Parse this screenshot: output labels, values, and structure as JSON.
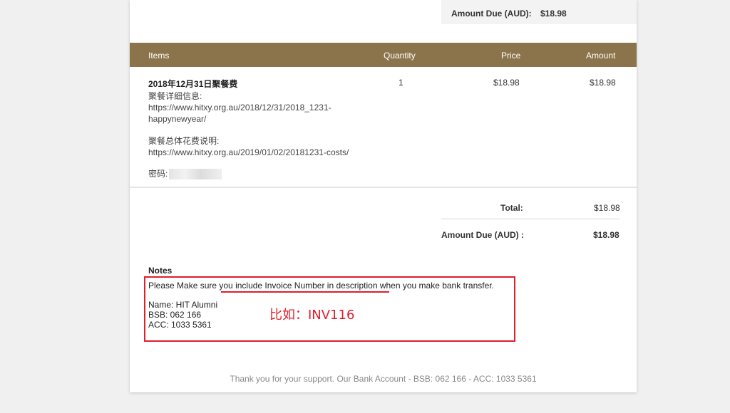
{
  "invoice": {
    "amount_due_top_label": "Amount Due (AUD):",
    "amount_due_top_value": "$18.98",
    "columns": {
      "items": "Items",
      "quantity": "Quantity",
      "price": "Price",
      "amount": "Amount"
    },
    "line_item": {
      "title": "2018年12月31日聚餐费",
      "desc_label_1": "聚餐详细信息:",
      "desc_url_1a": "https://www.hitxy.org.au/2018/12/31/2018_1231-",
      "desc_url_1b": "happynewyear/",
      "desc_label_2": "聚餐总体花费说明:",
      "desc_url_2": "https://www.hitxy.org.au/2019/01/02/20181231-costs/",
      "password_label": "密码:",
      "quantity": "1",
      "price": "$18.98",
      "amount": "$18.98"
    },
    "totals": {
      "total_label": "Total:",
      "total_value": "$18.98",
      "amount_due_label": "Amount Due (AUD) :",
      "amount_due_value": "$18.98"
    },
    "notes": {
      "title": "Notes",
      "line1": "Please Make sure you include Invoice Number in description when you make bank transfer.",
      "name": "Name: HIT Alumni",
      "bsb": "BSB: 062 166",
      "acc": "ACC: 1033 5361",
      "annotation": "比如：INV116"
    },
    "footer": "Thank you for your support.  Our Bank Account -  BSB: 062 166  - ACC: 1033 5361"
  },
  "colors": {
    "header_bg": "#8b744b",
    "annotation_red": "#e01e2c"
  }
}
